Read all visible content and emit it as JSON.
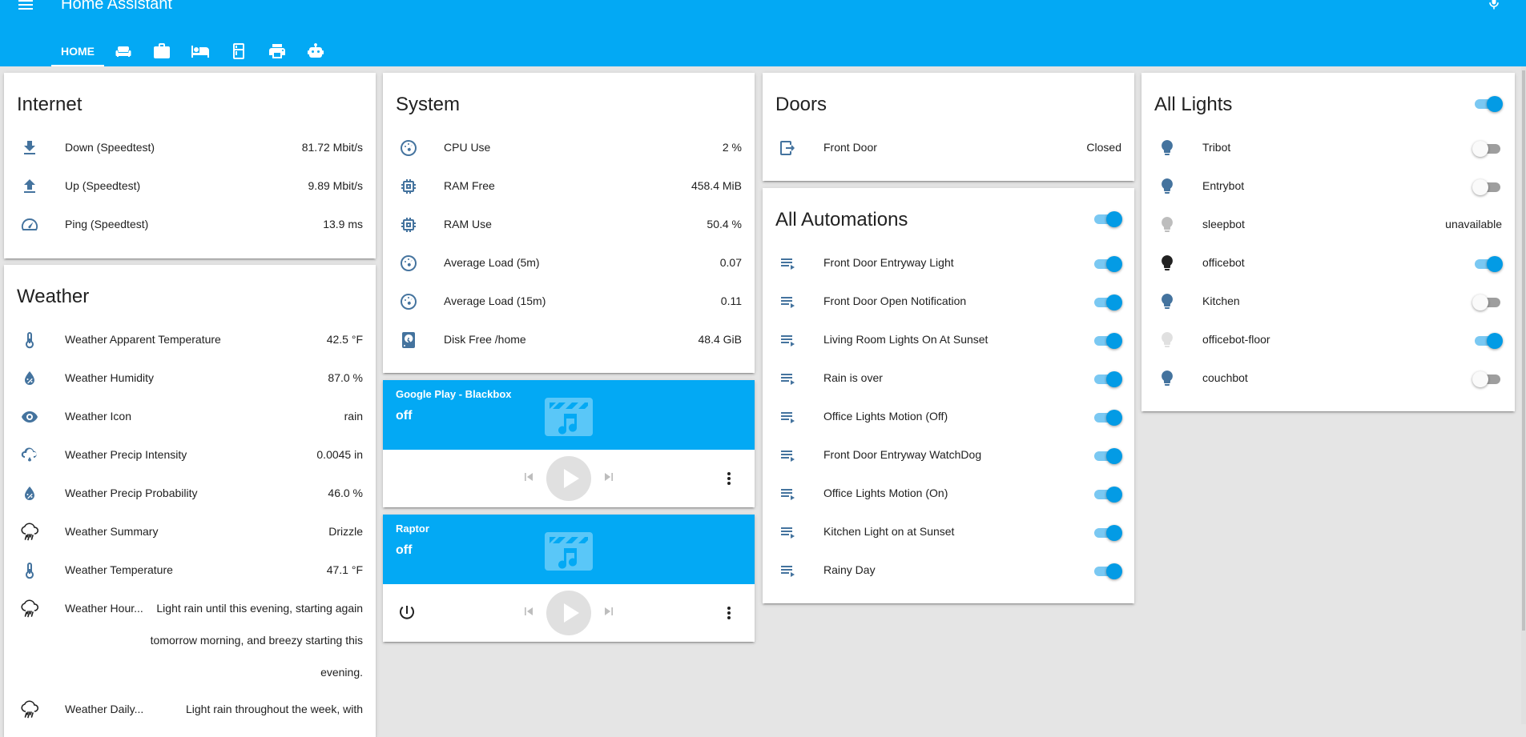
{
  "header": {
    "title": "Home Assistant",
    "bg_color": "#03a9f4",
    "tabs": [
      {
        "label": "HOME",
        "active": true
      },
      {
        "icon": "sofa-icon"
      },
      {
        "icon": "briefcase-icon"
      },
      {
        "icon": "bed-icon"
      },
      {
        "icon": "fridge-icon"
      },
      {
        "icon": "printer-icon"
      },
      {
        "icon": "robot-icon"
      }
    ]
  },
  "internet": {
    "title": "Internet",
    "rows": [
      {
        "icon": "download-icon",
        "name": "Down (Speedtest)",
        "value": "81.72 Mbit/s"
      },
      {
        "icon": "upload-icon",
        "name": "Up (Speedtest)",
        "value": "9.89 Mbit/s"
      },
      {
        "icon": "speedometer-icon",
        "name": "Ping (Speedtest)",
        "value": "13.9 ms"
      }
    ]
  },
  "weather": {
    "title": "Weather",
    "rows": [
      {
        "icon": "thermometer-icon",
        "name": "Weather Apparent Temperature",
        "value": "42.5 °F"
      },
      {
        "icon": "water-percent-icon",
        "name": "Weather Humidity",
        "value": "87.0 %"
      },
      {
        "icon": "eye-icon",
        "name": "Weather Icon",
        "value": "rain"
      },
      {
        "icon": "weather-rainy-icon",
        "name": "Weather Precip Intensity",
        "value": "0.0045 in"
      },
      {
        "icon": "water-percent-icon",
        "name": "Weather Precip Probability",
        "value": "46.0 %"
      },
      {
        "icon": "weather-pouring-icon",
        "name": "Weather Summary",
        "value": "Drizzle"
      },
      {
        "icon": "thermometer-icon",
        "name": "Weather Temperature",
        "value": "47.1 °F"
      },
      {
        "icon": "weather-pouring-icon",
        "name": "Weather Hour...",
        "value": "Light rain until this evening, starting again tomorrow morning, and breezy starting this evening."
      },
      {
        "icon": "weather-pouring-icon",
        "name": "Weather Daily...",
        "value": "Light rain throughout the week, with"
      }
    ]
  },
  "system": {
    "title": "System",
    "rows": [
      {
        "icon": "gauge-icon",
        "name": "CPU Use",
        "value": "2 %"
      },
      {
        "icon": "memory-icon",
        "name": "RAM Free",
        "value": "458.4 MiB"
      },
      {
        "icon": "memory-icon",
        "name": "RAM Use",
        "value": "50.4 %"
      },
      {
        "icon": "gauge-icon",
        "name": "Average Load (5m)",
        "value": "0.07"
      },
      {
        "icon": "gauge-icon",
        "name": "Average Load (15m)",
        "value": "0.11"
      },
      {
        "icon": "harddisk-icon",
        "name": "Disk Free /home",
        "value": "48.4 GiB"
      }
    ]
  },
  "media": [
    {
      "name": "Google Play - Blackbox",
      "state": "off",
      "has_power": false
    },
    {
      "name": "Raptor",
      "state": "off",
      "has_power": true
    }
  ],
  "doors": {
    "title": "Doors",
    "rows": [
      {
        "icon": "door-exit-icon",
        "name": "Front Door",
        "value": "Closed"
      }
    ]
  },
  "automations": {
    "title": "All Automations",
    "master_on": true,
    "rows": [
      {
        "name": "Front Door Entryway Light",
        "on": true
      },
      {
        "name": "Front Door Open Notification",
        "on": true
      },
      {
        "name": "Living Room Lights On At Sunset",
        "on": true
      },
      {
        "name": "Rain is over",
        "on": true
      },
      {
        "name": "Office Lights Motion (Off)",
        "on": true
      },
      {
        "name": "Front Door Entryway WatchDog",
        "on": true
      },
      {
        "name": "Office Lights Motion (On)",
        "on": true
      },
      {
        "name": "Kitchen Light on at Sunset",
        "on": true
      },
      {
        "name": "Rainy Day",
        "on": true
      }
    ]
  },
  "lights": {
    "title": "All Lights",
    "master_on": true,
    "rows": [
      {
        "name": "Tribot",
        "on": false,
        "icon_color": "#44739e"
      },
      {
        "name": "Entrybot",
        "on": false,
        "icon_color": "#44739e"
      },
      {
        "name": "sleepbot",
        "state": "unavailable",
        "icon_color": "#bdbdbd"
      },
      {
        "name": "officebot",
        "on": true,
        "icon_color": "#212121"
      },
      {
        "name": "Kitchen",
        "on": false,
        "icon_color": "#44739e"
      },
      {
        "name": "officebot-floor",
        "on": true,
        "icon_color": "#e0e0e0"
      },
      {
        "name": "couchbot",
        "on": false,
        "icon_color": "#44739e"
      }
    ]
  }
}
